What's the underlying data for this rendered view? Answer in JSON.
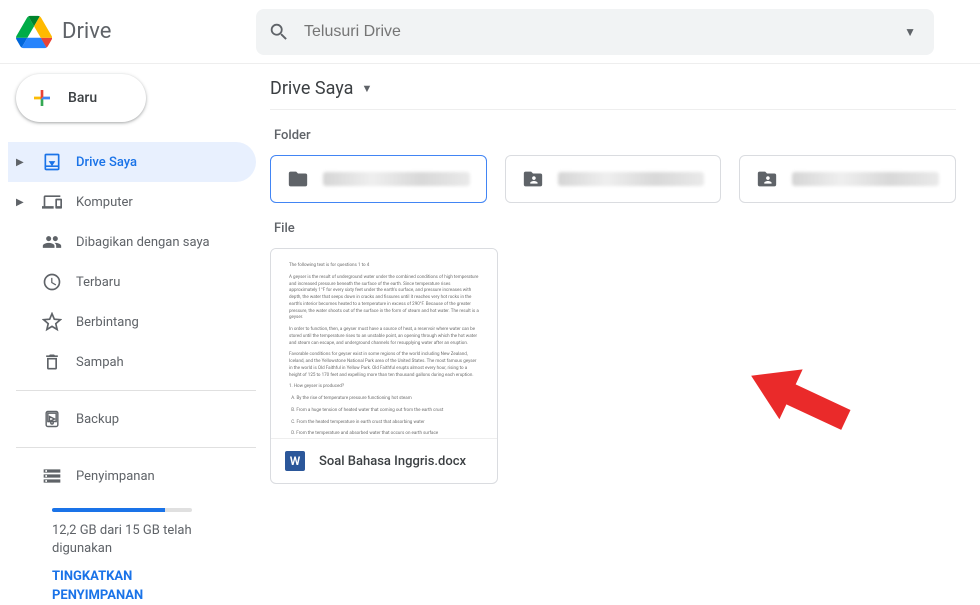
{
  "header": {
    "app_title": "Drive",
    "search_placeholder": "Telusuri Drive"
  },
  "sidebar": {
    "new_button": "Baru",
    "nav": [
      {
        "id": "mydrive",
        "label": "Drive Saya",
        "icon": "drive",
        "active": true,
        "has_arrow": true
      },
      {
        "id": "computers",
        "label": "Komputer",
        "icon": "devices",
        "active": false,
        "has_arrow": true
      },
      {
        "id": "shared",
        "label": "Dibagikan dengan saya",
        "icon": "shared",
        "active": false,
        "has_arrow": false
      },
      {
        "id": "recent",
        "label": "Terbaru",
        "icon": "clock",
        "active": false,
        "has_arrow": false
      },
      {
        "id": "starred",
        "label": "Berbintang",
        "icon": "star",
        "active": false,
        "has_arrow": false
      },
      {
        "id": "trash",
        "label": "Sampah",
        "icon": "trash",
        "active": false,
        "has_arrow": false
      }
    ],
    "backup": {
      "label": "Backup",
      "icon": "backup"
    },
    "storage": {
      "label": "Penyimpanan",
      "usage_text": "12,2 GB dari 15 GB telah digunakan",
      "fill_percent": 81,
      "upgrade_label": "TINGKATKAN PENYIMPANAN"
    }
  },
  "main": {
    "title": "Drive Saya",
    "folder_section_label": "Folder",
    "file_section_label": "File",
    "folders": [
      {
        "icon": "folder",
        "name_obscured": true,
        "selected": true
      },
      {
        "icon": "shared-folder",
        "name_obscured": true,
        "selected": false
      },
      {
        "icon": "shared-folder",
        "name_obscured": true,
        "selected": false
      }
    ],
    "files": [
      {
        "icon": "word",
        "name": "Soal Bahasa Inggris.docx"
      }
    ]
  },
  "annotation": {
    "arrow_color": "#ea2a2a"
  }
}
